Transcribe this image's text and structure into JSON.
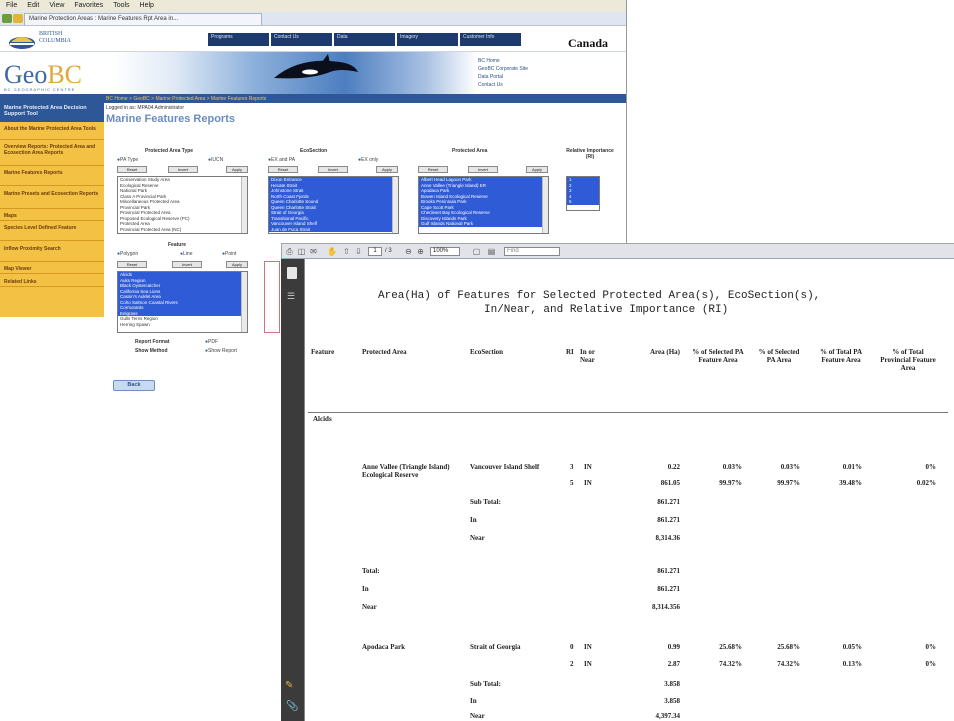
{
  "browser": {
    "menu": [
      "File",
      "Edit",
      "View",
      "Favorites",
      "Tools",
      "Help"
    ],
    "tab_title": "Marine Protection Areas : Marine Features Rpt Area in..."
  },
  "header": {
    "bc_logo_line1": "BRITISH",
    "bc_logo_line2": "COLUMBIA",
    "canada": "Canada",
    "geobc_geo": "Geo",
    "geobc_bc": "BC",
    "geobc_sub": "BC GEOGRAPHIC CENTRE",
    "quick_links": [
      "BC Home",
      "GeoBC Corporate Site",
      "Data Portal",
      "Contact Us"
    ],
    "top_tabs": [
      "Programs",
      "Contact Us",
      "Data",
      "Imagery",
      "Customer Info"
    ]
  },
  "breadcrumb": "BC Home > GeoBC > Marine Protected Area > Marine Features Reports",
  "user": "Logged in as: MPA04 Administrator",
  "page_title": "Marine Features Reports",
  "left_nav": {
    "header": "Marine Protected Area Decision Support Tool",
    "items": [
      "About the Marine Protected Area Tools",
      "Overview Reports: Protected Area and Ecosection Area Reports",
      "Marine Features Reports",
      "Marine Presets and Ecosection Reports",
      "Maps",
      "Species Level Defined Feature",
      "Inflow Proximity Search",
      "Map Viewer",
      "Related Links"
    ]
  },
  "form": {
    "protected_area_type": {
      "label": "Protected Area Type",
      "radio1": "PA Type",
      "radio2": "IUCN",
      "buttons": [
        "Reset",
        "Invert",
        "Apply"
      ],
      "options": [
        "Conservation Study Area",
        "Ecological Reserve",
        "National Park",
        "Class A Provincial Park",
        "Miscellaneous Protected Area",
        "Provincial Park",
        "Provincial Protected Area",
        "Proposed Ecological Reserve (PC)",
        "Protected Area",
        "Provincial Protected Area (NC)"
      ]
    },
    "ecosection": {
      "label": "EcoSection",
      "radio1": "EX and PA",
      "radio2": "EX only",
      "buttons": [
        "Reset",
        "Invert",
        "Apply"
      ],
      "options": [
        "Dixon Entrance",
        "Hecate Strait",
        "Johnstone Strait",
        "North Coast Fjords",
        "Queen Charlotte Sound",
        "Queen Charlotte Strait",
        "Strait of Georgia",
        "Transitional Pacific",
        "Vancouver Island Shelf",
        "Juan de Fuca Strait"
      ]
    },
    "protected_area": {
      "label": "Protected Area",
      "buttons": [
        "Reset",
        "Invert",
        "Apply"
      ],
      "options": [
        "Albert Head Lagoon Park",
        "Anne Vallee (Triangle Island) ER",
        "Apodaca Park",
        "Bowen Island Ecological Reserve",
        "Brooks Peninsula Park",
        "Cape Scott Park",
        "Checleset Bay Ecological Reserve",
        "Discovery Islands Park",
        "Gulf Islands National Park"
      ]
    },
    "relative_importance": {
      "label": "Relative Importance (RI)",
      "options": [
        "1",
        "2",
        "3",
        "4",
        "5"
      ]
    },
    "feature": {
      "label": "Feature",
      "radio1": "Polygon",
      "radio2": "Line",
      "radio3": "Point",
      "buttons": [
        "Reset",
        "Invert",
        "Apply"
      ],
      "options": [
        "Alcids",
        "Auks Region",
        "Black Oystercatcher",
        "California Sea Lions",
        "Cassin's Auklet Area",
        "Coho Salmon Coastal Rivers",
        "Cormorants",
        "Eelgrass",
        "Gulls Terns Region",
        "Herring Spawn"
      ]
    },
    "report_format_label": "Report Format",
    "report_format_value": "PDF",
    "show_method_label": "Show Method",
    "show_method_value": "Show Report",
    "back_button": "Back"
  },
  "pdf_viewer": {
    "page_value": "1",
    "page_total": "/ 3",
    "zoom": "100%",
    "find_placeholder": "Find"
  },
  "report": {
    "title_line1": "Area(Ha) of Features for Selected Protected Area(s), EcoSection(s),",
    "title_line2": "In/Near, and Relative Importance (RI)",
    "columns": [
      "Feature",
      "Protected Area",
      "EcoSection",
      "RI",
      "In or Near",
      "Area (Ha)",
      "% of Selected PA Feature Area",
      "% of Selected PA Area",
      "% of Total PA Feature Area",
      "% of Total Provincial Feature Area"
    ],
    "feature_group": "Alcids",
    "block1": {
      "protected_area": "Anne Vallee (Triangle Island) Ecological Reserve",
      "ecosection": "Vancouver Island Shelf",
      "rows": [
        {
          "ri": "3",
          "in_near": "IN",
          "area": "0.22",
          "pct_sel_pa_feat": "0.03%",
          "pct_sel_pa": "0.03%",
          "pct_total_pa_feat": "0.01%",
          "pct_total_prov": "0%"
        },
        {
          "ri": "5",
          "in_near": "IN",
          "area": "861.05",
          "pct_sel_pa_feat": "99.97%",
          "pct_sel_pa": "99.97%",
          "pct_total_pa_feat": "39.48%",
          "pct_total_prov": "0.02%"
        }
      ],
      "subtotal_label": "Sub Total:",
      "subtotal": "861.271",
      "in_label": "In",
      "in_value": "861.271",
      "near_label": "Near",
      "near_value": "8,314.36"
    },
    "totals": {
      "total_label": "Total:",
      "total": "861.271",
      "in_label": "In",
      "in_value": "861.271",
      "near_label": "Near",
      "near_value": "8,314.356"
    },
    "block2": {
      "protected_area": "Apodaca Park",
      "ecosection": "Strait of Georgia",
      "rows": [
        {
          "ri": "0",
          "in_near": "IN",
          "area": "0.99",
          "pct_sel_pa_feat": "25.68%",
          "pct_sel_pa": "25.68%",
          "pct_total_pa_feat": "0.05%",
          "pct_total_prov": "0%"
        },
        {
          "ri": "2",
          "in_near": "IN",
          "area": "2.87",
          "pct_sel_pa_feat": "74.32%",
          "pct_sel_pa": "74.32%",
          "pct_total_pa_feat": "0.13%",
          "pct_total_prov": "0%"
        }
      ],
      "subtotal_label": "Sub Total:",
      "subtotal": "3.858",
      "in_label": "In",
      "in_value": "3.858",
      "near_label": "Near",
      "near_value": "4,397.34"
    }
  }
}
